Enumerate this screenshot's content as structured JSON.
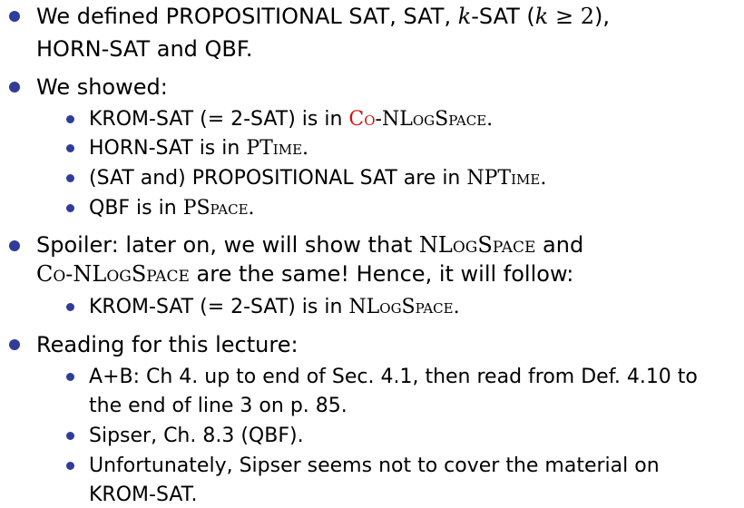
{
  "items": [
    {
      "text_a": "We defined PROPOSITIONAL SAT, SAT, ",
      "k_var": "k",
      "text_b": "-SAT (",
      "k_var2": "k",
      "geq": " ≥ ",
      "two": "2",
      "text_c": "),",
      "text_d": "HORN-SAT and QBF."
    },
    {
      "text": "We showed:",
      "subitems": [
        {
          "text_a": "KROM-SAT (",
          "eq": "=",
          "text_b": " 2-SAT) is in ",
          "class_co": "Co",
          "class_rest": "-NLogSpace",
          "period": "."
        },
        {
          "text_a": "HORN-SAT is in ",
          "class": "PTime",
          "period": "."
        },
        {
          "text_a": "(SAT and) PROPOSITIONAL SAT are in ",
          "class": "NPTime",
          "period": "."
        },
        {
          "text_a": "QBF is in ",
          "class": "PSpace",
          "period": "."
        }
      ]
    },
    {
      "text_a": "Spoiler: later on, we will show that ",
      "class_a": "NLogSpace",
      "text_b": " and",
      "class_b": "Co-NLogSpace",
      "text_c": " are the same! Hence, it will follow:",
      "subitems": [
        {
          "text_a": "KROM-SAT (",
          "eq": "=",
          "text_b": " 2-SAT) is in ",
          "class": "NLogSpace",
          "period": "."
        }
      ]
    },
    {
      "text": "Reading for this lecture:",
      "subitems": [
        {
          "line1": "A",
          "plus": "+",
          "line1b": "B: Ch 4. up to end of Sec. 4.1, then read from Def. 4.10 to",
          "line2": "the end of line 3 on p. 85."
        },
        {
          "line1": "Sipser, Ch. 8.3 (QBF)."
        },
        {
          "line1": "Unfortunately, Sipser seems not to cover the material on",
          "line2": "KROM-SAT."
        }
      ]
    }
  ],
  "colors": {
    "bullet": "#2f3c9a",
    "highlight_red": "#d11414",
    "text": "#000000"
  }
}
